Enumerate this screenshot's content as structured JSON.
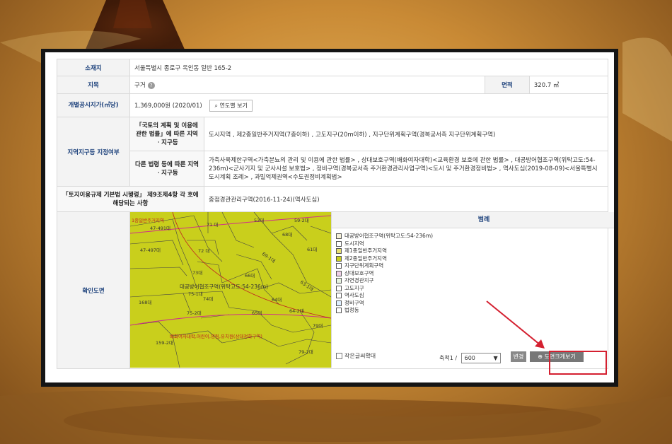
{
  "info": {
    "location_label": "소재지",
    "location_value": "서울특별시 종로구 옥인동 일반 165-2",
    "landuse_label": "지목",
    "landuse_value": "구거",
    "area_label": "면적",
    "area_value": "320.7 ㎡",
    "price_label": "개별공시지가(㎡당)",
    "price_value": "1,369,000원 (2020/01)",
    "price_button": "연도별 보기",
    "zone_label": "지역지구등 지정여부",
    "zone_sub1_label": "「국토의 계획 및 이용에 관한 법률」에 따른 지역ㆍ지구등",
    "zone_sub1_value": "도시지역 , 제2종일반주거지역(7층이하) , 고도지구(20m이하) , 지구단위계획구역(경복궁서측 지구단위계획구역)",
    "zone_sub2_label": "다른 법령 등에 따른 지역ㆍ지구등",
    "zone_sub2_value": "가축사육제한구역<가축분뇨의 관리 및 이용에 관한 법률> , 상대보호구역(배화여자대학)<교육환경 보호에 관한 법률> , 대공방어협조구역(위탁고도:54-236m)<군사기지 및 군사시설 보호법> , 정비구역(경복궁서측 주거환경관리사업구역)<도시 및 주거환경정비법> , 역사도심(2019-08-09)<서울특별시 도시계획 조례> , 과밀억제권역<수도권정비계획법>",
    "reg_label": "「토지이용규제 기본법 시행령」 제9조제4항 각 호에 해당되는 사항",
    "reg_value": "중점경관관리구역(2016-11-24)(역사도심)",
    "map_label": "확인도면"
  },
  "legend": {
    "title": "범례",
    "items": [
      {
        "label": "대공방어협조구역(위탁고도:54-236m)",
        "color": "#f5f0d8"
      },
      {
        "label": "도시지역",
        "color": "#ffffff"
      },
      {
        "label": "제1종일반주거지역",
        "color": "#e8e070"
      },
      {
        "label": "제2종일반주거지역",
        "color": "#c9cf1c"
      },
      {
        "label": "지구단위계획구역",
        "color": "#ffffff"
      },
      {
        "label": "상대보호구역",
        "color": "#f0d0e8"
      },
      {
        "label": "자연경관지구",
        "color": "#e8f5e0"
      },
      {
        "label": "고도지구",
        "color": "#ffffff"
      },
      {
        "label": "역사도심",
        "color": "#ffffff"
      },
      {
        "label": "정비구역",
        "color": "#e0f0ff"
      },
      {
        "label": "법정동",
        "color": "#ffffff"
      }
    ]
  },
  "controls": {
    "small_text_label": "작은글씨확대",
    "scale_label": "축척1 /",
    "scale_value": "600",
    "change_button": "변경",
    "zoom_button": "도면크게보기"
  },
  "map": {
    "labels": [
      "1종일반주거지역",
      "47-491대",
      "71 대",
      "53대",
      "59-2대",
      "68대",
      "47-497대",
      "72 대",
      "61대",
      "69-1대",
      "73대",
      "66대",
      "75-1대",
      "74대",
      "64대",
      "168대",
      "대공방어협조구역(위탁고도:54-236m)",
      "64-2대",
      "65대",
      "75-2대",
      "79대",
      "배화여자대학,어린이,영림,유치원(상대정화구역)",
      "159-2대",
      "79-2대",
      "63-1대"
    ]
  }
}
